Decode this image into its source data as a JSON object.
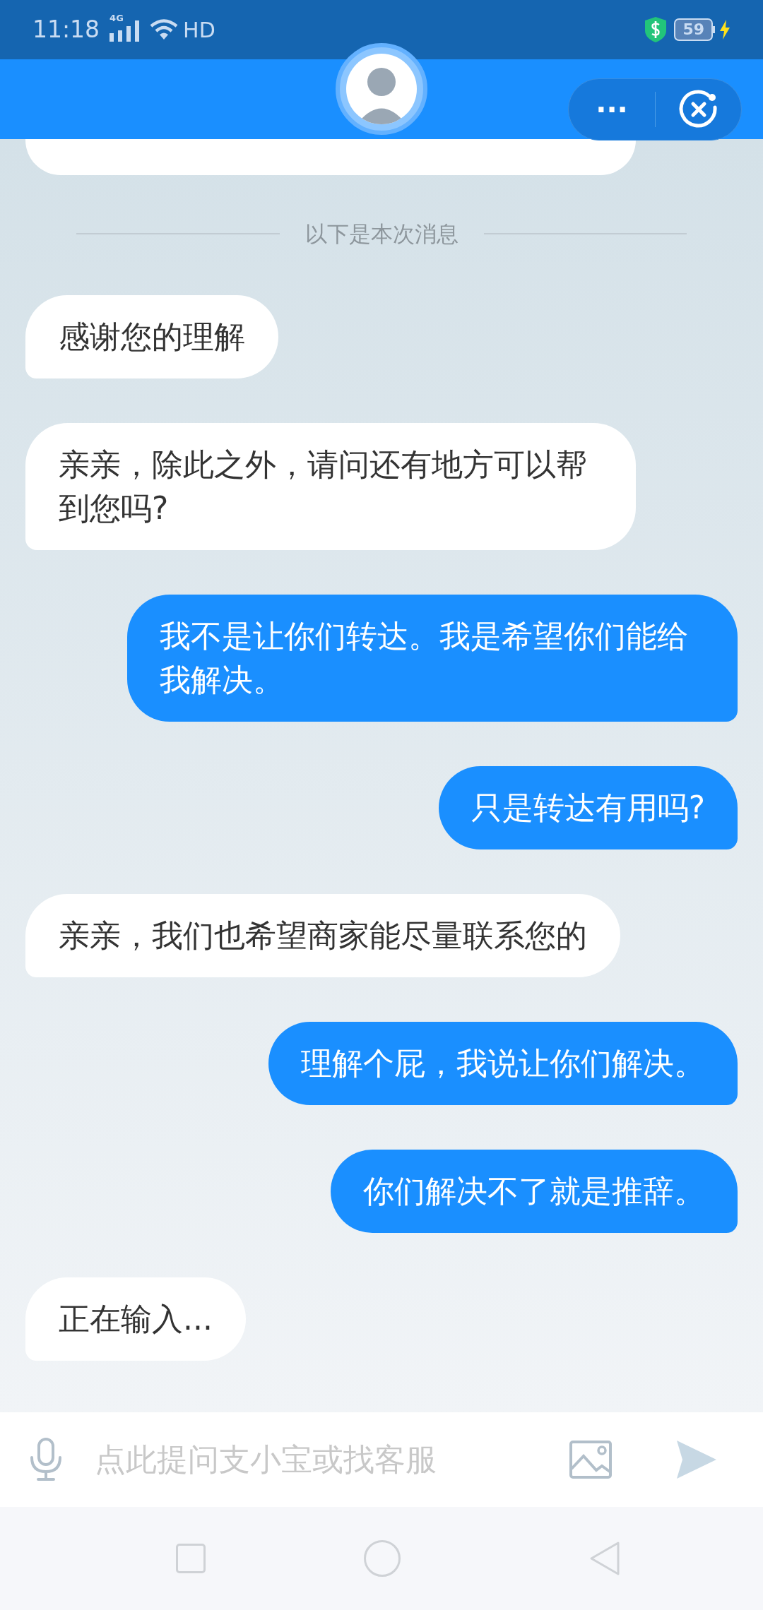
{
  "status_bar": {
    "time": "11:18",
    "network": "4G",
    "hd": "HD",
    "battery": "59",
    "charging": true
  },
  "header": {
    "more": "···"
  },
  "divider": "以下是本次消息",
  "messages": [
    {
      "kind": "received",
      "text": "感谢您的理解"
    },
    {
      "kind": "received",
      "text": "亲亲，除此之外，请问还有地方可以帮到您吗?"
    },
    {
      "kind": "sent",
      "text": "我不是让你们转达。我是希望你们能给我解决。"
    },
    {
      "kind": "sent",
      "text": "只是转达有用吗?"
    },
    {
      "kind": "received",
      "text": "亲亲，我们也希望商家能尽量联系您的"
    },
    {
      "kind": "sent",
      "text": "理解个屁，我说让你们解决。"
    },
    {
      "kind": "sent",
      "text": "你们解决不了就是推辞。"
    },
    {
      "kind": "received",
      "text": "正在输入..."
    }
  ],
  "input": {
    "placeholder": "点此提问支小宝或找客服"
  }
}
